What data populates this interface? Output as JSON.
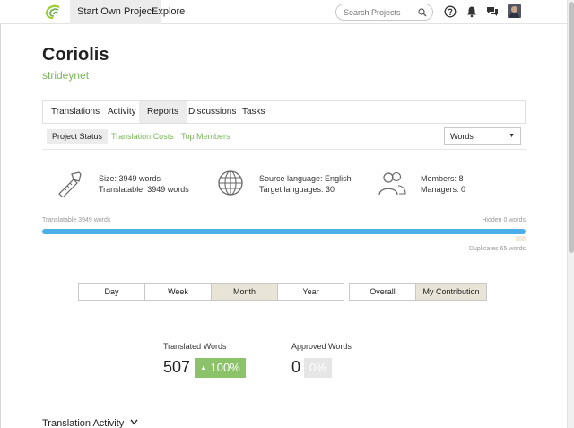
{
  "topbar": {
    "start_project": "Start Own Project",
    "explore": "Explore",
    "search_placeholder": "Search Projects"
  },
  "project": {
    "title": "Coriolis",
    "owner": "strideynet"
  },
  "tabs": [
    {
      "label": "Translations"
    },
    {
      "label": "Activity"
    },
    {
      "label": "Reports"
    },
    {
      "label": "Discussions"
    },
    {
      "label": "Tasks"
    }
  ],
  "subnav": {
    "items": [
      {
        "label": "Project Status"
      },
      {
        "label": "Translation Costs"
      },
      {
        "label": "Top Members"
      }
    ],
    "unit_select": "Words"
  },
  "stats": {
    "size": "Size: 3949 words",
    "translatable": "Translatable: 3949 words",
    "source_lang": "Source language: English",
    "target_langs": "Target languages: 30",
    "members": "Members: 8",
    "managers": "Managers: 0"
  },
  "progress": {
    "left_label": "Translatable 3949 words",
    "right_label": "Hidden 0 words",
    "dup_label": "Duplicates 65 words",
    "translatable_fraction": 1.0
  },
  "periods": {
    "items": [
      "Day",
      "Week",
      "Month",
      "Year"
    ],
    "active": "Month"
  },
  "scope": {
    "items": [
      "Overall",
      "My Contribution"
    ],
    "active": "My Contribution"
  },
  "metrics": {
    "translated_label": "Translated Words",
    "translated_value": "507",
    "translated_pct": "100%",
    "approved_label": "Approved Words",
    "approved_value": "0",
    "approved_pct": "0%"
  },
  "section": {
    "title": "Translation Activity"
  },
  "colors": {
    "accent_green": "#7ab55c",
    "progress_blue": "#4aaee8",
    "badge_green": "#8cc36a"
  }
}
